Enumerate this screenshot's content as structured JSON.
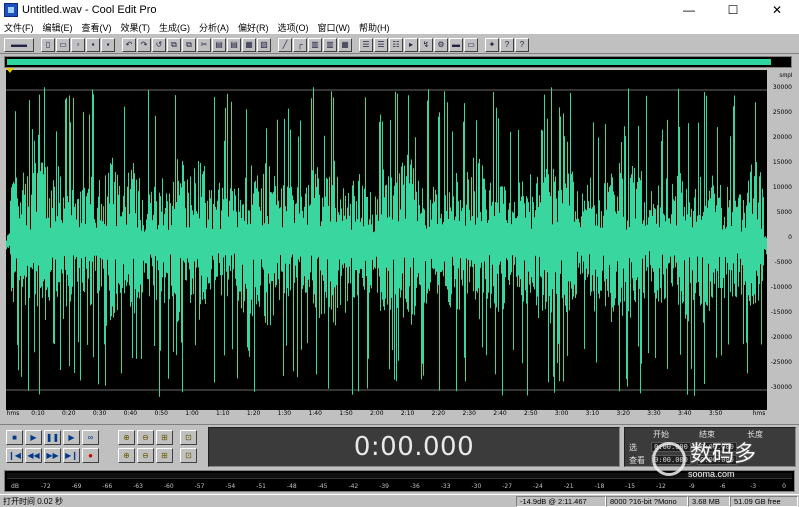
{
  "window": {
    "title": "Untitled.wav - Cool Edit Pro",
    "minimize": "—",
    "maximize": "☐",
    "close": "✕"
  },
  "menu": [
    "文件(F)",
    "编辑(E)",
    "查看(V)",
    "效果(T)",
    "生成(G)",
    "分析(A)",
    "偏好(R)",
    "选项(O)",
    "窗口(W)",
    "帮助(H)"
  ],
  "waveform": {
    "color": "#3ad6a0",
    "background": "#000000",
    "amplitude_unit": "smpl",
    "amplitude_labels": [
      "30000",
      "25000",
      "20000",
      "15000",
      "10000",
      "5000",
      "0",
      "-5000",
      "-10000",
      "-15000",
      "-20000",
      "-25000",
      "-30000"
    ],
    "time_labels": [
      "hms",
      "0:10",
      "0:20",
      "0:30",
      "0:40",
      "0:50",
      "1:00",
      "1:10",
      "1:20",
      "1:30",
      "1:40",
      "1:50",
      "2:00",
      "2:10",
      "2:20",
      "2:30",
      "2:40",
      "2:50",
      "3:00",
      "3:10",
      "3:20",
      "3:30",
      "3:40",
      "3:50",
      "hms"
    ]
  },
  "transport": {
    "stop": "■",
    "play": "▶",
    "pause": "❚❚",
    "play_to_end": "▶",
    "loop": "∞",
    "go_start": "❙◀",
    "rewind": "◀◀",
    "fast_forward": "▶▶",
    "go_end": "▶❙",
    "record": "●"
  },
  "zoom": {
    "zoom_in_h": "⊕",
    "zoom_out_h": "⊖",
    "zoom_full_h": "⊞",
    "zoom_sel_h": "⊡",
    "zoom_in_v": "⊕",
    "zoom_out_v": "⊖",
    "zoom_full_v": "⊞",
    "zoom_sel_v": "⊡"
  },
  "time_display": "0:00.000",
  "selection_panel": {
    "col_begin": "开始",
    "col_end": "结束",
    "col_length": "长度",
    "row_selection": "选",
    "row_view": "查看",
    "sel_begin": "0:00.000",
    "sel_end": "0:00.000",
    "view_begin": "0:00.000",
    "view_end": "0:00.000"
  },
  "meter_labels": [
    "dB",
    "-72",
    "-69",
    "-66",
    "-63",
    "-60",
    "-57",
    "-54",
    "-51",
    "-48",
    "-45",
    "-42",
    "-39",
    "-36",
    "-33",
    "-30",
    "-27",
    "-24",
    "-21",
    "-18",
    "-15",
    "-12",
    "-9",
    "-6",
    "-3",
    "0"
  ],
  "status": {
    "open_time": "打开时间  0.02 秒",
    "level": "-14.9dB @  2:11.467",
    "format": "8000 ?16-bit ?Mono",
    "file_size": "3.68 MB",
    "free_space": "51.09 GB free"
  },
  "watermark": {
    "text": "数码多",
    "url": "sooma.com"
  }
}
